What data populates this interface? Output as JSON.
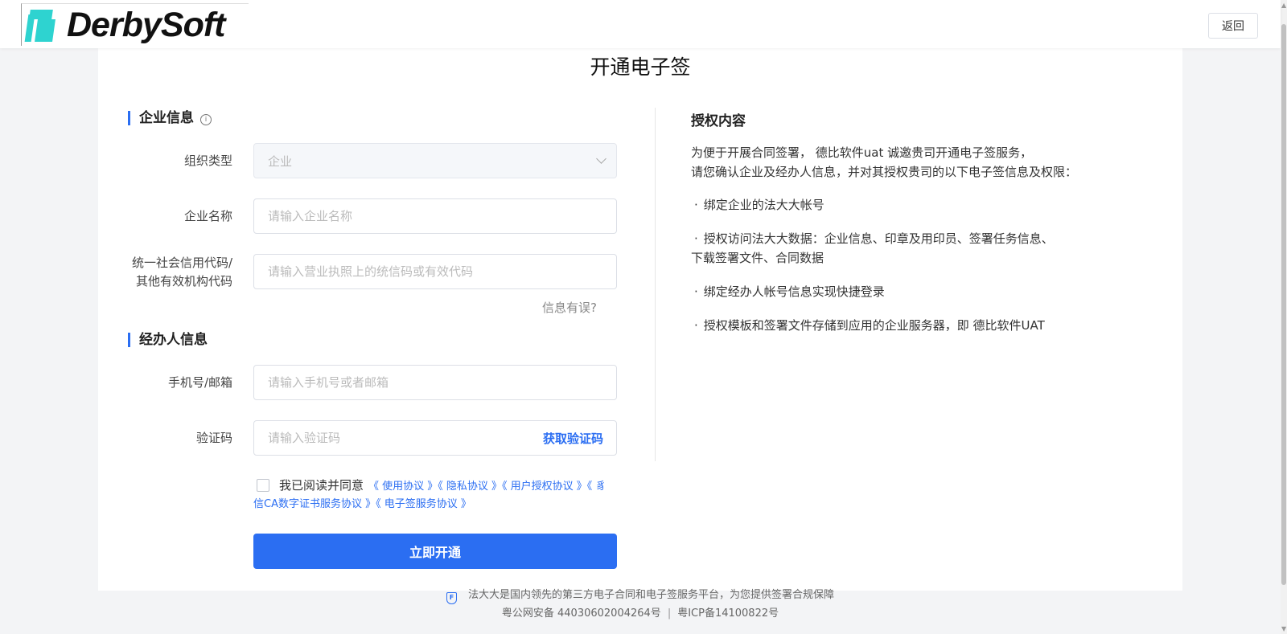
{
  "header": {
    "logo_text": "DerbySoft",
    "back_label": "返回"
  },
  "page": {
    "title": "开通电子签"
  },
  "company_section": {
    "title": "企业信息",
    "info_icon": "i",
    "org_type": {
      "label": "组织类型",
      "value": "企业"
    },
    "company_name": {
      "label": "企业名称",
      "placeholder": "请输入企业名称"
    },
    "credit_code": {
      "label_line1": "统一社会信用代码/",
      "label_line2": "其他有效机构代码",
      "placeholder": "请输入营业执照上的统信码或有效代码"
    },
    "info_wrong_link": "信息有误?"
  },
  "handler_section": {
    "title": "经办人信息",
    "phone": {
      "label": "手机号/邮箱",
      "placeholder": "请输入手机号或者邮箱"
    },
    "code": {
      "label": "验证码",
      "placeholder": "请输入验证码",
      "send_label": "获取验证码"
    }
  },
  "agreement": {
    "label": "我已阅读并同意",
    "line1_links": "《 使用协议 》《 隐私协议 》《 用户授权协议 》《 豸",
    "line2_links": "信CA数字证书服务协议 》《 电子签服务协议 》"
  },
  "submit_label": "立即开通",
  "auth": {
    "title": "授权内容",
    "intro_line1": "为便于开展合同签署， 德比软件uat 诚邀贵司开通电子签服务，",
    "intro_line2": "请您确认企业及经办人信息，并对其授权贵司的以下电子签信息及权限：",
    "bullet_char": "·",
    "items": [
      {
        "line1": "绑定企业的法大大帐号"
      },
      {
        "line1": "授权访问法大大数据：企业信息、印章及用印员、签署任务信息、",
        "line2": "下载签署文件、合同数据"
      },
      {
        "line1": "绑定经办人帐号信息实现快捷登录"
      },
      {
        "line1": "授权模板和签署文件存储到应用的企业服务器，即 德比软件UAT"
      }
    ]
  },
  "footer": {
    "shield_glyph": "F",
    "tagline": "法大大是国内领先的第三方电子合同和电子签服务平台，为您提供签署合规保障",
    "police_record": "粤公网安备 44030602004264号",
    "separator": "|",
    "icp_record": "粤ICP备14100822号"
  },
  "colors": {
    "accent": "#2b6ef2",
    "logo_mark": "#2ed3d0"
  }
}
